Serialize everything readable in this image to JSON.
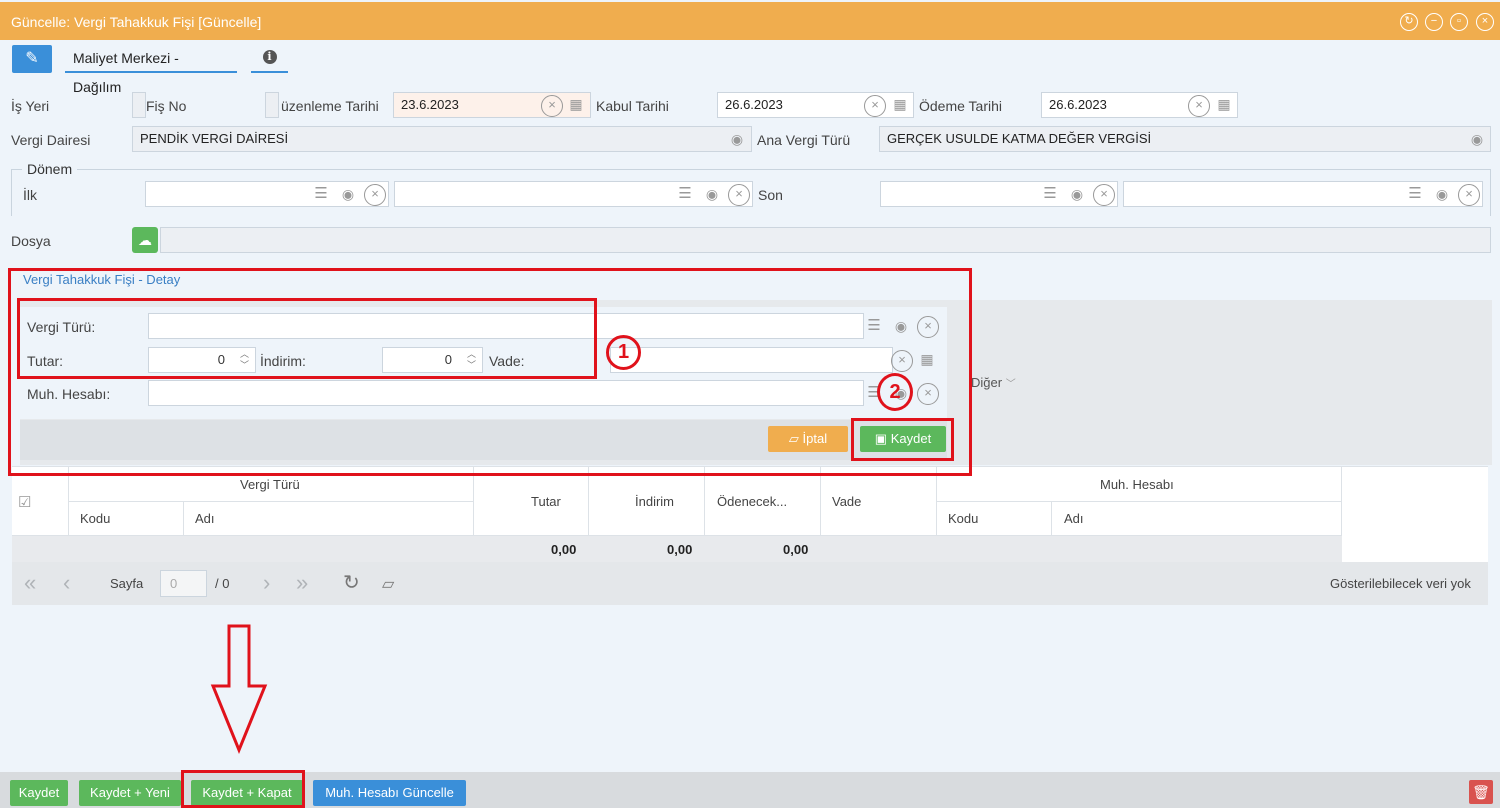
{
  "window": {
    "title": "Güncelle: Vergi Tahakkuk Fişi [Güncelle]",
    "controls": [
      "refresh-icon",
      "minimize-icon",
      "maximize-icon",
      "close-icon"
    ]
  },
  "tabs": {
    "edit_icon": "edit-icon",
    "cost_center": "Maliyet Merkezi - Dağılım",
    "info_icon": "info-icon"
  },
  "form": {
    "workplace_label": "İş Yeri",
    "slip_no_label": "Fiş No",
    "edit_date_label": "üzenleme Tarihi",
    "edit_date_value": "23.6.2023",
    "accept_date_label": "Kabul Tarihi",
    "accept_date_value": "26.6.2023",
    "payment_date_label": "Ödeme Tarihi",
    "payment_date_value": "26.6.2023",
    "tax_office_label": "Vergi Dairesi",
    "tax_office_value": "PENDİK VERGİ DAİRESİ",
    "main_tax_type_label": "Ana Vergi Türü",
    "main_tax_type_value": "GERÇEK USULDE KATMA DEĞER VERGİSİ",
    "period_legend": "Dönem",
    "first_label": "İlk",
    "last_label": "Son",
    "file_label": "Dosya"
  },
  "detail": {
    "title": "Vergi Tahakkuk Fişi - Detay",
    "tax_type_label": "Vergi Türü:",
    "amount_label": "Tutar:",
    "amount_value": "0",
    "discount_label": "İndirim:",
    "discount_value": "0",
    "due_label": "Vade:",
    "account_label": "Muh. Hesabı:",
    "cancel_label": "İptal",
    "save_label": "Kaydet",
    "other_label": "Diğer"
  },
  "grid": {
    "group_tax_type": "Vergi Türü",
    "code": "Kodu",
    "name": "Adı",
    "amount": "Tutar",
    "discount": "İndirim",
    "payable": "Ödenecek...",
    "due": "Vade",
    "group_account": "Muh. Hesabı",
    "code2": "Kodu",
    "name2": "Adı",
    "total_amount": "0,00",
    "total_discount": "0,00",
    "total_payable": "0,00"
  },
  "pager": {
    "page_label": "Sayfa",
    "page_value": "0",
    "page_total": "/ 0",
    "empty_text": "Gösterilebilecek veri yok"
  },
  "footer": {
    "save": "Kaydet",
    "save_new": "Kaydet + Yeni",
    "save_close": "Kaydet + Kapat",
    "update_account": "Muh. Hesabı Güncelle"
  },
  "annotations": {
    "marker_1": "1",
    "marker_2": "2",
    "color": "#e0121b"
  }
}
